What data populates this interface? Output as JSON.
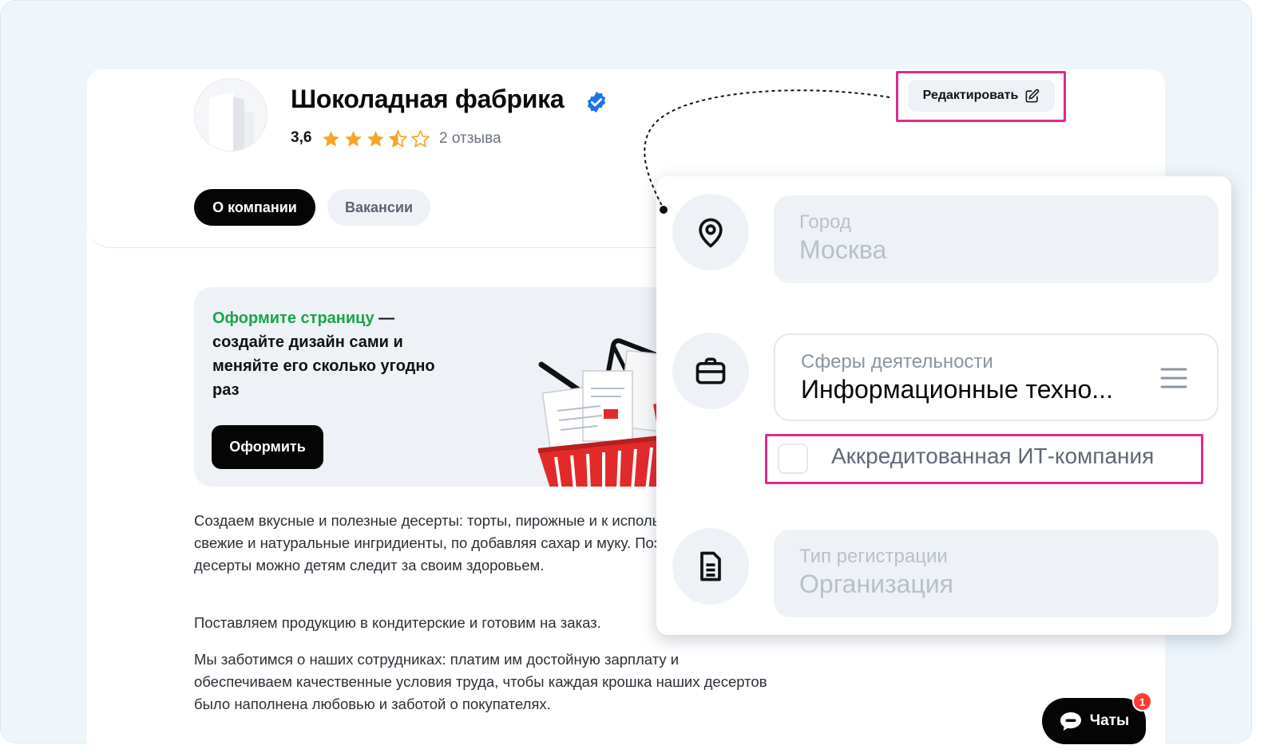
{
  "company": {
    "name": "Шоколадная фабрика",
    "rating": "3,6",
    "rating_value": 3.6,
    "rating_max": 5,
    "reviews": "2 отзыва"
  },
  "tabs": [
    {
      "label": "О компании",
      "active": true
    },
    {
      "label": "Вакансии",
      "active": false
    }
  ],
  "promo": {
    "highlight": "Оформите страницу",
    "text": " — создайте дизайн сами и меняйте его сколько угодно раз",
    "button": "Оформить"
  },
  "description": [
    "Создаем вкусные и полезные десерты: торты, пирожные и к используем только свежие и натуральные ингридиенты, по добавляя сахар и муку. Поэтому наши десерты можно детям следит за своим здоровьем.",
    "Поставляем продукцию в кондитерские и готовим на заказ.",
    "Мы заботимся о наших сотрудниках: платим им достойную зарплату и обеспечиваем качественные условия труда, чтобы каждая крошка наших десертов было наполнена любовью и заботой о покупателях."
  ],
  "edit_button": {
    "label": "Редактировать",
    "icon": "edit-icon"
  },
  "panel": {
    "city": {
      "label": "Город",
      "value": "Москва",
      "icon": "location-pin-icon"
    },
    "spheres": {
      "label": "Сферы деятельности",
      "value": "Информационные техно...",
      "icon": "briefcase-icon"
    },
    "accredited": {
      "label": "Аккредитованная ИТ-компания",
      "checked": false
    },
    "registration": {
      "label": "Тип регистрации",
      "value": "Организация",
      "icon": "document-icon"
    }
  },
  "chats": {
    "label": "Чаты",
    "badge": "1",
    "icon": "chat-bubble-icon"
  },
  "colors": {
    "accent_green": "#1ea24d",
    "highlight_pink": "#df2a8e",
    "star": "#f5a623",
    "verified": "#1a73e8",
    "badge_red": "#ff3b30"
  }
}
